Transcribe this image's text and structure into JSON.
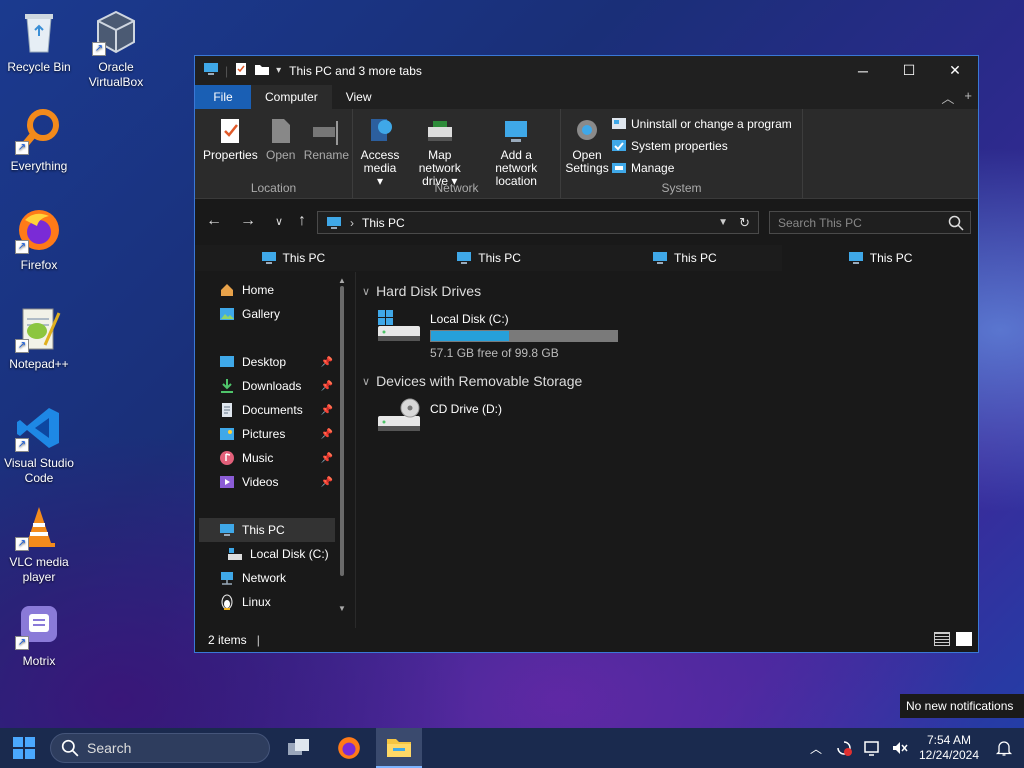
{
  "desktop": {
    "icons": [
      {
        "label": "Recycle Bin",
        "icon": "recycle-bin-icon"
      },
      {
        "label": "Oracle VirtualBox",
        "icon": "virtualbox-icon"
      },
      {
        "label": "Everything",
        "icon": "everything-search-icon"
      },
      {
        "label": "Firefox",
        "icon": "firefox-icon"
      },
      {
        "label": "Notepad++",
        "icon": "notepad-plus-plus-icon"
      },
      {
        "label": "Visual Studio Code",
        "icon": "vscode-icon"
      },
      {
        "label": "VLC media player",
        "icon": "vlc-icon"
      },
      {
        "label": "Motrix",
        "icon": "motrix-icon"
      }
    ]
  },
  "explorer": {
    "title": "This PC and 3 more tabs",
    "ribbon_tabs": {
      "file": "File",
      "computer": "Computer",
      "view": "View"
    },
    "ribbon": {
      "location": {
        "label": "Location",
        "properties": "Properties",
        "open": "Open",
        "rename": "Rename"
      },
      "network": {
        "label": "Network",
        "access_media": "Access media ▾",
        "map_drive": "Map network drive ▾",
        "add_location": "Add a network location"
      },
      "system": {
        "label": "System",
        "open_settings": "Open Settings",
        "uninstall": "Uninstall or change a program",
        "sys_props": "System properties",
        "manage": "Manage"
      }
    },
    "address": {
      "path": "This PC",
      "search_placeholder": "Search This PC"
    },
    "tabs": [
      "This PC",
      "This PC",
      "This PC",
      "This PC"
    ],
    "nav": {
      "home": "Home",
      "gallery": "Gallery",
      "desktop": "Desktop",
      "downloads": "Downloads",
      "documents": "Documents",
      "pictures": "Pictures",
      "music": "Music",
      "videos": "Videos",
      "this_pc": "This PC",
      "local_disk": "Local Disk (C:)",
      "network": "Network",
      "linux": "Linux"
    },
    "groups": {
      "hdd": "Hard Disk Drives",
      "removable": "Devices with Removable Storage"
    },
    "drives": {
      "c": {
        "name": "Local Disk (C:)",
        "free_text": "57.1 GB free of 99.8 GB",
        "used_fraction": 0.428
      },
      "d": {
        "name": "CD Drive (D:)"
      }
    },
    "status": {
      "items": "2 items"
    }
  },
  "notification": "No new notifications",
  "taskbar": {
    "search_label": "Search",
    "time": "7:54 AM",
    "date": "12/24/2024"
  },
  "colors": {
    "accent": "#1a5fb4",
    "usage_fill": "#26a0da",
    "window_border": "#3a78d6"
  }
}
